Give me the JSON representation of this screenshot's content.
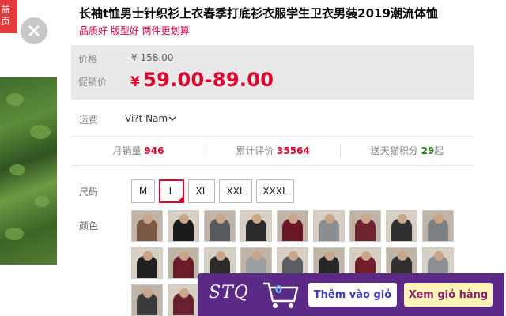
{
  "left_panel": {
    "tag_text": "益\n页",
    "close_icon": "close-icon"
  },
  "product": {
    "title": "长袖t恤男士针织衫上衣春季打底衫衣服学生卫衣男装2019潮流体恤",
    "subtitle": "品质好 版型好 两件更划算"
  },
  "price": {
    "label_price": "价格",
    "old_price": "¥ 158.00",
    "label_promo": "促销价",
    "currency": "¥",
    "promo_price": "59.00-89.00"
  },
  "shipping": {
    "label": "运费",
    "value": "Vi?t Nam"
  },
  "stats": {
    "monthly_sales_label": "月销量",
    "monthly_sales": "946",
    "reviews_label": "累计评价",
    "reviews": "35564",
    "points_label": "送天猫积分",
    "points": "29",
    "points_suffix": "起"
  },
  "size": {
    "label": "尺码",
    "options": [
      "M",
      "L",
      "XL",
      "XXL",
      "XXXL"
    ],
    "selected": "L"
  },
  "color": {
    "label": "颜色",
    "swatches": [
      {
        "c": "#7b5a45"
      },
      {
        "c": "#1b1b1b"
      },
      {
        "c": "#555a5e"
      },
      {
        "c": "#2a2a2a"
      },
      {
        "c": "#6b1826"
      },
      {
        "c": "#8a8e93"
      },
      {
        "c": "#6e2430"
      },
      {
        "c": "#303030"
      },
      {
        "c": "#7c7f83"
      },
      {
        "c": "#202020"
      },
      {
        "c": "#6a1c28"
      },
      {
        "c": "#2b2b2b"
      },
      {
        "c": "#9a9da1"
      },
      {
        "c": "#5a5d61"
      },
      {
        "c": "#262626"
      },
      {
        "c": "#711d2b"
      },
      {
        "c": "#2f2f2f"
      },
      {
        "c": "#8c8f93"
      },
      {
        "c": "#3a3a3a"
      },
      {
        "c": "#682030"
      }
    ]
  },
  "stq": {
    "logo": "STQ",
    "cart_count": "0",
    "add_button": "Thêm vào giỏ",
    "view_button": "Xem giỏ hàng",
    "colors": {
      "bar": "#5b2a86",
      "view_bg": "#fff5b8"
    }
  }
}
